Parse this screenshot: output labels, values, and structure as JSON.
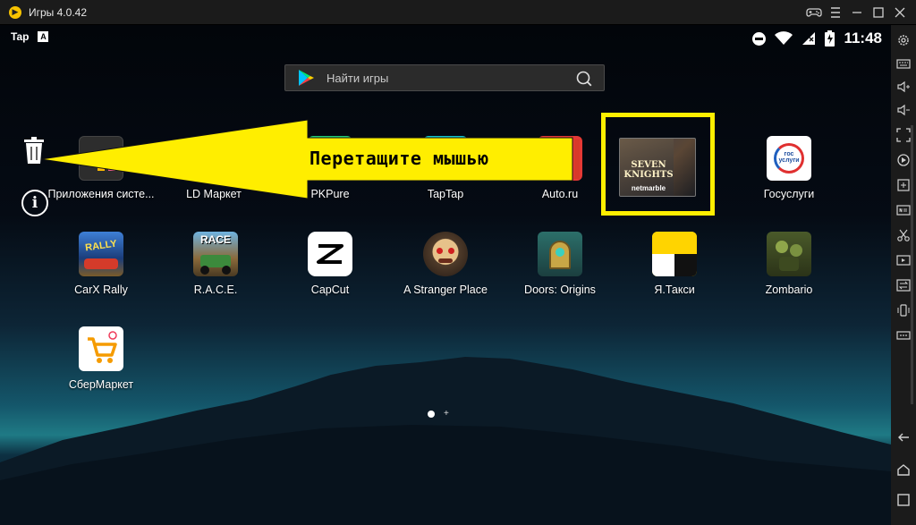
{
  "window": {
    "title": "Игры 4.0.42",
    "controls": [
      "gamepad-icon",
      "settings-icon",
      "minimize-icon",
      "maximize-icon",
      "close-icon"
    ]
  },
  "statusbar": {
    "left_label": "Tap",
    "left_badge": "A",
    "time": "11:48"
  },
  "search": {
    "placeholder": "Найти игры"
  },
  "overlay": {
    "arrow_text": "Перетащите мышью"
  },
  "apps_row1": [
    {
      "label": "Приложения систе...",
      "icon": "system-apps-folder-icon"
    },
    {
      "label": "LD Маркет",
      "icon": "ld-market-icon"
    },
    {
      "label": "PKPure",
      "icon": "apkpure-icon"
    },
    {
      "label": "TapTap",
      "icon": "taptap-icon"
    },
    {
      "label": "Auto.ru",
      "icon": "autoru-icon"
    },
    {
      "label": "",
      "icon": "seven-knights-icon",
      "art_text": "SEVEN KNIGHTS",
      "art_sub": "netmarble"
    },
    {
      "label": "Госуслуги",
      "icon": "gosuslugi-icon",
      "art_text": "гос услуги"
    }
  ],
  "apps_row2": [
    {
      "label": "CarX Rally",
      "icon": "carx-rally-icon",
      "art_text": "RALLY"
    },
    {
      "label": "R.A.C.E.",
      "icon": "race-icon",
      "art_text": "RACE"
    },
    {
      "label": "CapCut",
      "icon": "capcut-icon"
    },
    {
      "label": "A Stranger Place",
      "icon": "stranger-place-icon"
    },
    {
      "label": "Doors: Origins",
      "icon": "doors-origins-icon"
    },
    {
      "label": "Я.Такси",
      "icon": "yandex-taxi-icon"
    },
    {
      "label": "Zombario",
      "icon": "zombario-icon"
    }
  ],
  "apps_row3": [
    {
      "label": "СберМаркет",
      "icon": "sbermarket-icon"
    }
  ],
  "colors": {
    "highlight": "#ffee00",
    "arrow": "#ffee00"
  },
  "pager": {
    "current": 1,
    "plus": "+"
  }
}
